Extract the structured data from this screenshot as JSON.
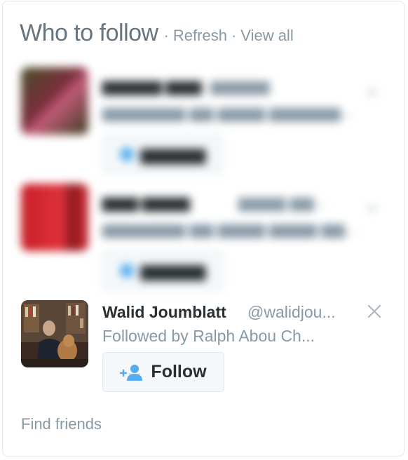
{
  "header": {
    "title": "Who to follow",
    "separator": "·",
    "refresh_label": "Refresh",
    "view_all_label": "View all"
  },
  "suggestions": [
    {
      "name": "",
      "handle": "",
      "followed_by": "",
      "follow_label": "",
      "blurred": true,
      "avatar_color": "#6b3a3a"
    },
    {
      "name": "",
      "handle": "",
      "followed_by": "",
      "follow_label": "",
      "blurred": true,
      "avatar_color": "#d0202a"
    },
    {
      "name": "Walid Joumblatt",
      "handle": "@walidjou...",
      "followed_by_prefix": "Followed by",
      "followed_by_name": "Ralph Abou Ch...",
      "follow_label": "Follow",
      "follow_icon": "add-user-icon",
      "dismiss_icon": "close-icon",
      "blurred": false
    }
  ],
  "footer": {
    "find_friends_label": "Find friends"
  },
  "colors": {
    "accent_blue": "#55acee",
    "muted_text": "#8899a6",
    "title_text": "#66757f",
    "name_text": "#292f33",
    "border": "#e1e8ed"
  }
}
